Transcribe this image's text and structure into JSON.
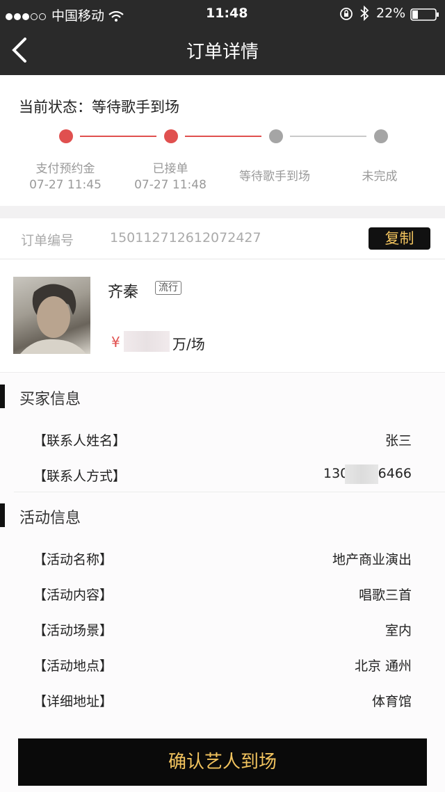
{
  "status_bar": {
    "carrier": "中国移动",
    "time": "11:48",
    "battery": "22%",
    "icons": [
      "signal-dots-icon",
      "wifi-icon",
      "rotation-lock-icon",
      "bluetooth-icon",
      "battery-icon"
    ]
  },
  "header": {
    "title": "订单详情",
    "back_icon": "chevron-left-icon"
  },
  "status": {
    "current_label": "当前状态：等待歌手到场",
    "steps": [
      {
        "label": "支付预约金",
        "time": "07-27 11:45",
        "done": true
      },
      {
        "label": "已接单",
        "time": "07-27 11:48",
        "done": true
      },
      {
        "label": "等待歌手到场",
        "time": "",
        "done": false
      },
      {
        "label": "未完成",
        "time": "",
        "done": false
      }
    ],
    "active_color": "#e0504f",
    "inactive_color": "#a5a5a5"
  },
  "order": {
    "label": "订单编号",
    "number": "150112712612072427",
    "copy_label": "复制"
  },
  "artist": {
    "name": "齐秦",
    "genre": "流行",
    "price_symbol": "¥",
    "price_unit": "万/场"
  },
  "buyer": {
    "title": "买家信息",
    "rows": [
      {
        "label": "【联系人姓名】",
        "value": "张三"
      },
      {
        "label": "【联系人方式】",
        "value_prefix": "130",
        "value_suffix": "6466"
      }
    ]
  },
  "event": {
    "title": "活动信息",
    "rows": [
      {
        "label": "【活动名称】",
        "value": "地产商业演出"
      },
      {
        "label": "【活动内容】",
        "value": "唱歌三首"
      },
      {
        "label": "【活动场景】",
        "value": "室内"
      },
      {
        "label": "【活动地点】",
        "value": "北京 通州"
      },
      {
        "label": "【详细地址】",
        "value": "体育馆"
      }
    ]
  },
  "footer": {
    "confirm_label": "确认艺人到场"
  },
  "colors": {
    "header_bg": "#2a2a2a",
    "accent_gold": "#f1c35e",
    "accent_red": "#e0504f"
  }
}
